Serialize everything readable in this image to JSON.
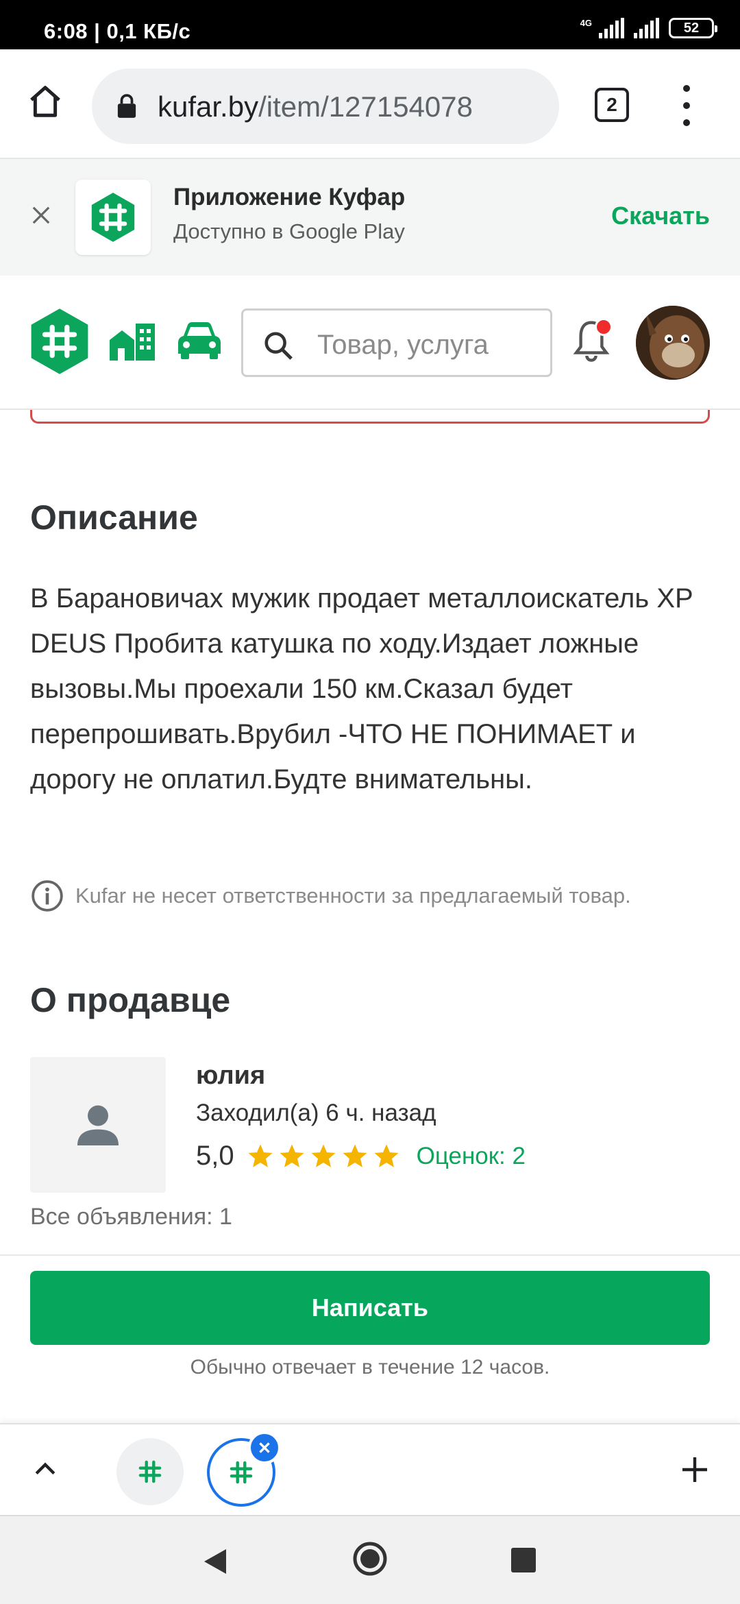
{
  "status_bar": {
    "time": "6:08",
    "speed": "0,1 КБ/с",
    "network": "4G",
    "battery": "52"
  },
  "browser": {
    "url_domain": "kufar.by",
    "url_path": "/item/127154078",
    "tab_count": "2"
  },
  "app_banner": {
    "title": "Приложение Куфар",
    "subtitle": "Доступно в Google Play",
    "action": "Скачать"
  },
  "header": {
    "search_placeholder": "Товар, услуга"
  },
  "description": {
    "heading": "Описание",
    "text": "В Барановичах мужик продает металлоискатель XP DEUS Пробита катушка по ходу.Издает ложные вызовы.Мы проехали 150 км.Сказал будет перепрошивать.Врубил -ЧТО НЕ ПОНИМАЕТ и дорогу не оплатил.Будте внимательны.",
    "disclaimer": "Kufar не несет ответственности за предлагаемый товар."
  },
  "seller": {
    "heading": "О продавце",
    "name": "юлия",
    "last_seen": "Заходил(а) 6 ч. назад",
    "rating": "5,0",
    "stars": 5,
    "reviews": "Оценок: 2",
    "all_ads": "Все объявления: 1"
  },
  "actions": {
    "write": "Написать",
    "reply_note": "Обычно отвечает в течение 12 часов."
  },
  "colors": {
    "brand_green": "#07a65d",
    "star": "#f5b400",
    "tab_accent": "#1a73e8"
  }
}
